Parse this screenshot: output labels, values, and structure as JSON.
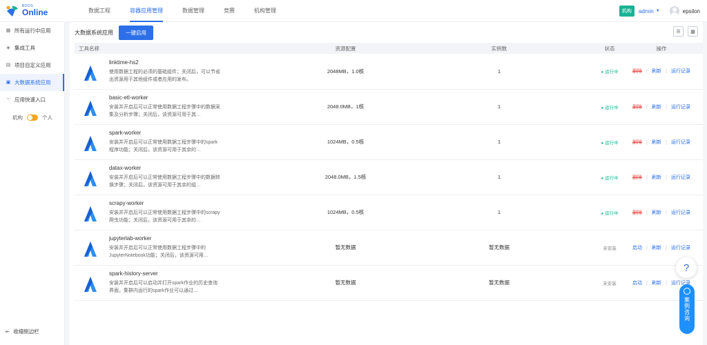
{
  "brand": {
    "small": "BDOS",
    "big": "Online"
  },
  "nav": [
    {
      "label": "数据工程",
      "active": false
    },
    {
      "label": "容器应用管理",
      "active": true
    },
    {
      "label": "数据管理",
      "active": false
    },
    {
      "label": "竞赛",
      "active": false
    },
    {
      "label": "机构管理",
      "active": false
    }
  ],
  "header": {
    "org_badge": "机构",
    "user_select": "admin",
    "username": "epsilon"
  },
  "sidebar": {
    "items": [
      {
        "label": "所有运行中应用",
        "icon": "grid-icon"
      },
      {
        "label": "集成工具",
        "icon": "layers-icon"
      },
      {
        "label": "项目自定义应用",
        "icon": "doc-icon"
      },
      {
        "label": "大数据系统应用",
        "icon": "database-icon",
        "active": true
      },
      {
        "label": "应用快速入口",
        "icon": "hand-icon"
      }
    ],
    "switch_left": "机构",
    "switch_right": "个人",
    "collapse": "收缩侧边栏"
  },
  "toolbar": {
    "title": "大数据系统应用",
    "button": "一键启用"
  },
  "table": {
    "headers": {
      "name": "工具名称",
      "res": "资源配置",
      "inst": "实例数",
      "status": "状态",
      "ops": "操作"
    },
    "rows": [
      {
        "name": "linktime-hs2",
        "desc": "使用数据工程的必须的基础组件；关闭后，可以节省出资源用于其他组件或者应用的发布。",
        "res": "2048MB，1.0核",
        "inst": "1",
        "status": "运行中",
        "running": true,
        "op1": "删除",
        "op2": "刷新",
        "op3": "运行记录"
      },
      {
        "name": "basic-etl-worker",
        "desc": "安装并开启后可以正常使用数据工程步骤中的数据采集及分析步骤；关闭后，该资源可用于其…",
        "res": "2048.0MB，1核",
        "inst": "1",
        "status": "运行中",
        "running": true,
        "op1": "删除",
        "op2": "刷新",
        "op3": "运行记录"
      },
      {
        "name": "spark-worker",
        "desc": "安装并开启后可以正常使用数据工程步骤中的spark程序功能；关闭后，该资源可用于其余的…",
        "res": "1024MB，0.5核",
        "inst": "1",
        "status": "运行中",
        "running": true,
        "op1": "删除",
        "op2": "刷新",
        "op3": "运行记录"
      },
      {
        "name": "datax-worker",
        "desc": "安装并开启后可以正常使用数据工程步骤中的数据转换步骤；关闭后，该资源可用于其余的组…",
        "res": "2048.0MB，1.5核",
        "inst": "1",
        "status": "运行中",
        "running": true,
        "op1": "删除",
        "op2": "刷新",
        "op3": "运行记录"
      },
      {
        "name": "scrapy-worker",
        "desc": "安装并开启后可以正常使用数据工程步骤中的scrapy爬虫功能；关闭后，该资源可用于其余的…",
        "res": "1024MB，0.5核",
        "inst": "1",
        "status": "运行中",
        "running": true,
        "op1": "删除",
        "op2": "刷新",
        "op3": "运行记录"
      },
      {
        "name": "jupyterlab-worker",
        "desc": "安装并开启后可以正常使用数据工程步骤中的JupyterNotebook功能；关闭后，该资源可用…",
        "res": "暂无数据",
        "inst": "暂无数据",
        "status": "未安装",
        "running": false,
        "op1": "启动",
        "op2": "刷新",
        "op3": "运行记录"
      },
      {
        "name": "spark-history-server",
        "desc": "安装并开启后可以启动并打开spark作业的历史查询界面，集群内运行的spark作业可以通过…",
        "res": "暂无数据",
        "inst": "暂无数据",
        "status": "未安装",
        "running": false,
        "op1": "启动",
        "op2": "刷新",
        "op3": "运行记录"
      }
    ]
  },
  "floating": {
    "help": "?",
    "consult": "案例咨询"
  },
  "colors": {
    "primary": "#2d6fe8",
    "success": "#19b393",
    "danger": "#e84a4a",
    "warning": "#f5a623"
  }
}
